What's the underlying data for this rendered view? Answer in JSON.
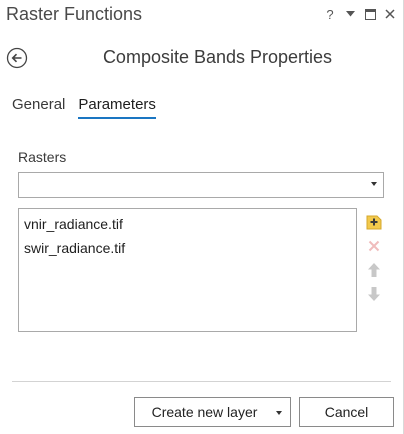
{
  "pane": {
    "title": "Raster Functions",
    "help_glyph": "?"
  },
  "header": {
    "title": "Composite Bands Properties"
  },
  "tabs": [
    {
      "label": "General",
      "active": false
    },
    {
      "label": "Parameters",
      "active": true
    }
  ],
  "rasters": {
    "label": "Rasters",
    "select_value": "",
    "items": [
      {
        "name": "vnir_radiance.tif"
      },
      {
        "name": "swir_radiance.tif"
      }
    ]
  },
  "buttons": {
    "create_label": "Create new layer",
    "cancel_label": "Cancel"
  },
  "colors": {
    "accent": "#1a76c2",
    "add_icon": "#f2c94c",
    "disabled_icon": "#c8c8c8"
  }
}
